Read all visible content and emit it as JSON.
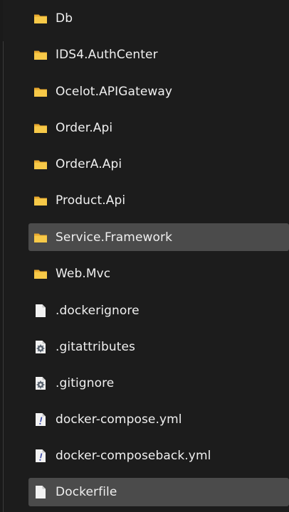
{
  "explorer": {
    "items": [
      {
        "label": "Db",
        "type": "folder",
        "icon": "folder-icon",
        "selected": false
      },
      {
        "label": "IDS4.AuthCenter",
        "type": "folder",
        "icon": "folder-icon",
        "selected": false
      },
      {
        "label": "Ocelot.APIGateway",
        "type": "folder",
        "icon": "folder-icon",
        "selected": false
      },
      {
        "label": "Order.Api",
        "type": "folder",
        "icon": "folder-icon",
        "selected": false
      },
      {
        "label": "OrderA.Api",
        "type": "folder",
        "icon": "folder-icon",
        "selected": false
      },
      {
        "label": "Product.Api",
        "type": "folder",
        "icon": "folder-icon",
        "selected": false
      },
      {
        "label": "Service.Framework",
        "type": "folder",
        "icon": "folder-icon",
        "selected": true
      },
      {
        "label": "Web.Mvc",
        "type": "folder",
        "icon": "folder-icon",
        "selected": false
      },
      {
        "label": ".dockerignore",
        "type": "file",
        "icon": "file-icon",
        "selected": false
      },
      {
        "label": ".gitattributes",
        "type": "settings-file",
        "icon": "settings-file-icon",
        "selected": false
      },
      {
        "label": ".gitignore",
        "type": "settings-file",
        "icon": "settings-file-icon",
        "selected": false
      },
      {
        "label": "docker-compose.yml",
        "type": "yaml-file",
        "icon": "yaml-file-icon",
        "selected": false
      },
      {
        "label": "docker-composeback.yml",
        "type": "yaml-file",
        "icon": "yaml-file-icon",
        "selected": false
      },
      {
        "label": "Dockerfile",
        "type": "file",
        "icon": "file-icon",
        "selected": true
      }
    ]
  },
  "colors": {
    "background": "#1c1c1c",
    "selected_row": "#4b4b4b",
    "text": "#f0f0f0",
    "folder": "#f5c242"
  }
}
